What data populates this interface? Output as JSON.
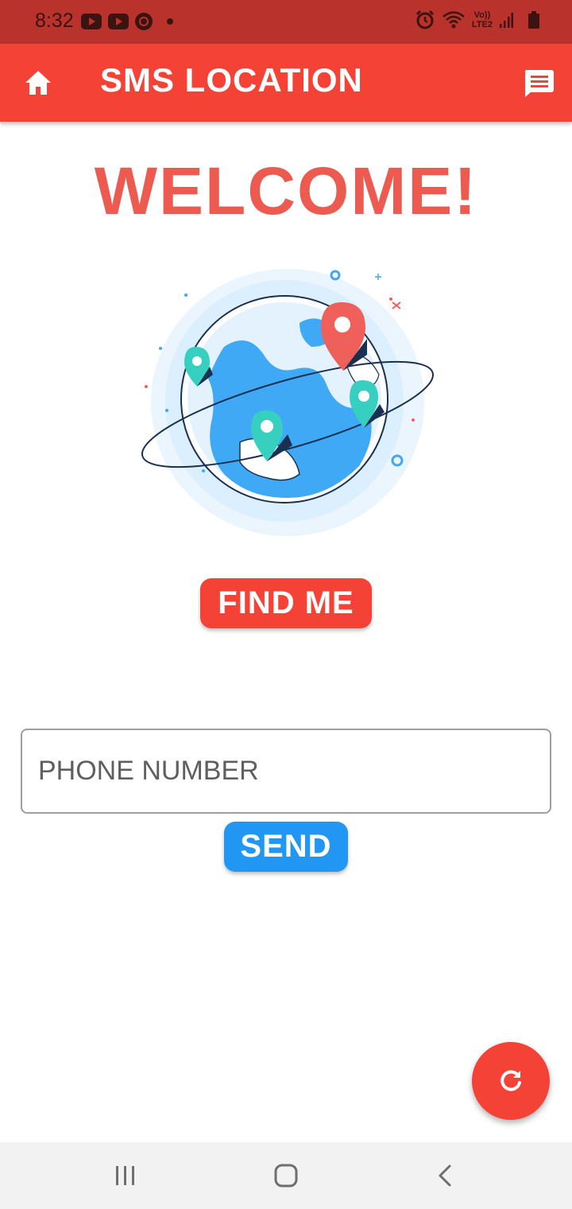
{
  "status_bar": {
    "time": "8:32",
    "icons": [
      "youtube-icon",
      "youtube-icon",
      "chrome-icon",
      "notification-dot-icon",
      "alarm-icon",
      "wifi-icon",
      "volte-lte2-icon",
      "signal-icon",
      "battery-icon"
    ],
    "network_label_top": "Vo))",
    "network_label_bottom": "LTE2"
  },
  "app_bar": {
    "title": "SMS LOCATION",
    "left_icon": "home-icon",
    "right_icon": "message-icon",
    "color": "#f44336"
  },
  "main": {
    "welcome_text": "WELCOME!",
    "welcome_color": "#ec5a50",
    "illustration": "globe-with-location-pins",
    "find_me_label": "FIND ME",
    "phone": {
      "value": "",
      "placeholder": "PHONE NUMBER"
    },
    "send_label": "SEND",
    "send_color": "#2196f3"
  },
  "fab": {
    "icon": "refresh-icon"
  },
  "nav_bar": {
    "icons": [
      "recents-icon",
      "home-nav-icon",
      "back-icon"
    ]
  }
}
